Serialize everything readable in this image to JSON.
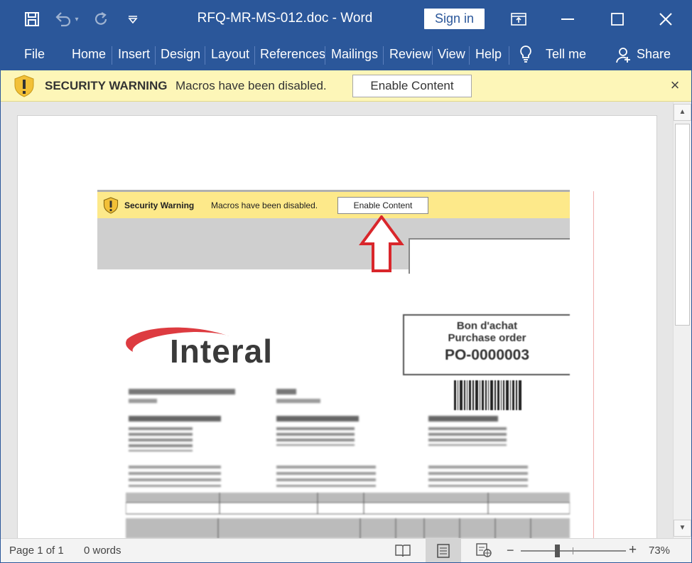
{
  "titlebar": {
    "doc_title": "RFQ-MR-MS-012.doc  -  Word",
    "sign_in": "Sign in"
  },
  "ribbon": {
    "tabs": [
      "File",
      "Home",
      "Insert",
      "Design",
      "Layout",
      "References",
      "Mailings",
      "Review",
      "View",
      "Help"
    ],
    "tell_me": "Tell me",
    "share": "Share"
  },
  "message_bar": {
    "title": "SECURITY WARNING",
    "text": "Macros have been disabled.",
    "button": "Enable Content"
  },
  "embedded_image": {
    "warning_title": "Security Warning",
    "warning_text": "Macros have been disabled.",
    "button": "Enable Content",
    "logo": "Interal",
    "po_line1": "Bon d'achat",
    "po_line2": "Purchase order",
    "po_number": "PO-0000003"
  },
  "status": {
    "page": "Page 1 of 1",
    "words": "0 words",
    "zoom": "73%",
    "zoom_level": 0.73
  },
  "colors": {
    "word_blue": "#2b579a",
    "message_bar": "#fdf6b8",
    "warning_yellow": "#f2c037",
    "arrow_red": "#d9262b"
  }
}
